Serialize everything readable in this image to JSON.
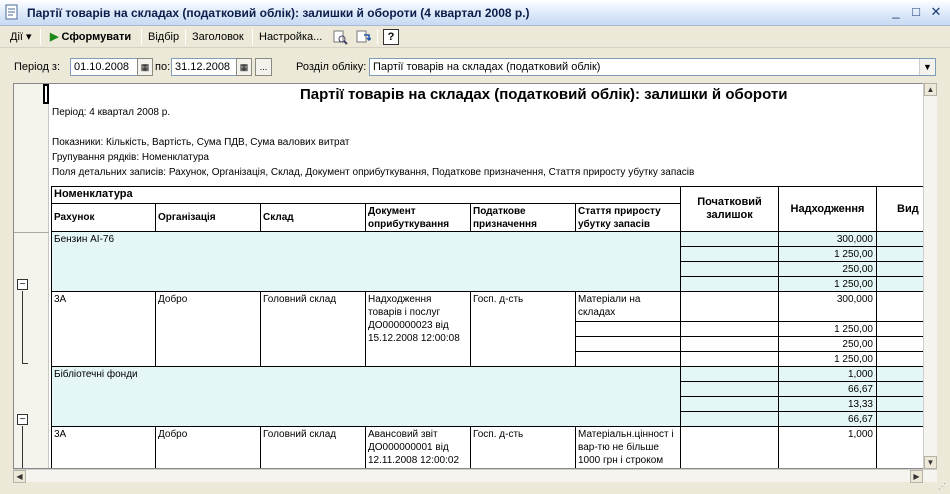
{
  "window": {
    "title": "Партії товарів на складах (податковий облік): залишки й обороти (4 квартал 2008 р.)",
    "minimize": "_",
    "maximize": "□",
    "close": "✕"
  },
  "toolbar": {
    "actions_label": "Дії",
    "generate_label": "Сформувати",
    "filter_label": "Відбір",
    "header_label": "Заголовок",
    "settings_label": "Настройка...",
    "help_label": "?"
  },
  "params": {
    "period_from_label": "Період з:",
    "date_from": "01.10.2008",
    "period_to_label": "по:",
    "date_to": "31.12.2008",
    "ellipsis": "...",
    "section_label": "Розділ обліку:",
    "section_value": "Партії товарів на складах (податковий облік)"
  },
  "report": {
    "title": "Партії товарів на складах (податковий облік): залишки й обороти",
    "period": "Період: 4 квартал 2008 р.",
    "indicators": "Показники:  Кількість, Вартість, Сума ПДВ, Сума валових витрат",
    "grouping": "Групування рядків: Номенклатура",
    "detail_fields": "Поля детальних записів:  Рахунок, Організація, Склад, Документ оприбуткування, Податкове призначення, Стаття приросту убутку запасів",
    "headers": {
      "nomenclature": "Номенклатура",
      "account": "Рахунок",
      "organization": "Організація",
      "warehouse": "Склад",
      "doc": "Документ оприбуткування",
      "tax_purpose": "Податкове призначення",
      "article": "Стаття приросту убутку запасів",
      "opening": "Початковий залишок",
      "receipt": "Надходження",
      "outflow": "Вид"
    },
    "rows": {
      "group1_name": "Бензин АІ-76",
      "group1_values": [
        "300,000",
        "1 250,00",
        "250,00",
        "1 250,00"
      ],
      "detail1": {
        "account": "3А",
        "organization": "Добро",
        "warehouse": "Головний склад",
        "doc": "Надходження товарів і послуг ДО000000023 від 15.12.2008 12:00:08",
        "tax_purpose": "Госп. д-сть",
        "article": "Матеріали на складах",
        "values": [
          "300,000",
          "1 250,00",
          "250,00",
          "1 250,00"
        ]
      },
      "group2_name": "Бібліотечні фонди",
      "group2_values": [
        "1,000",
        "66,67",
        "13,33",
        "66,67"
      ],
      "detail2": {
        "account": "3А",
        "organization": "Добро",
        "warehouse": "Головний склад",
        "doc": "Авансовий звіт ДО000000001 від 12.11.2008 12:00:02",
        "tax_purpose": "Госп. д-сть",
        "article": "Матеріальн.цінност і вар-тю не більше 1000 грн і строком",
        "values": [
          "1,000"
        ]
      }
    }
  }
}
